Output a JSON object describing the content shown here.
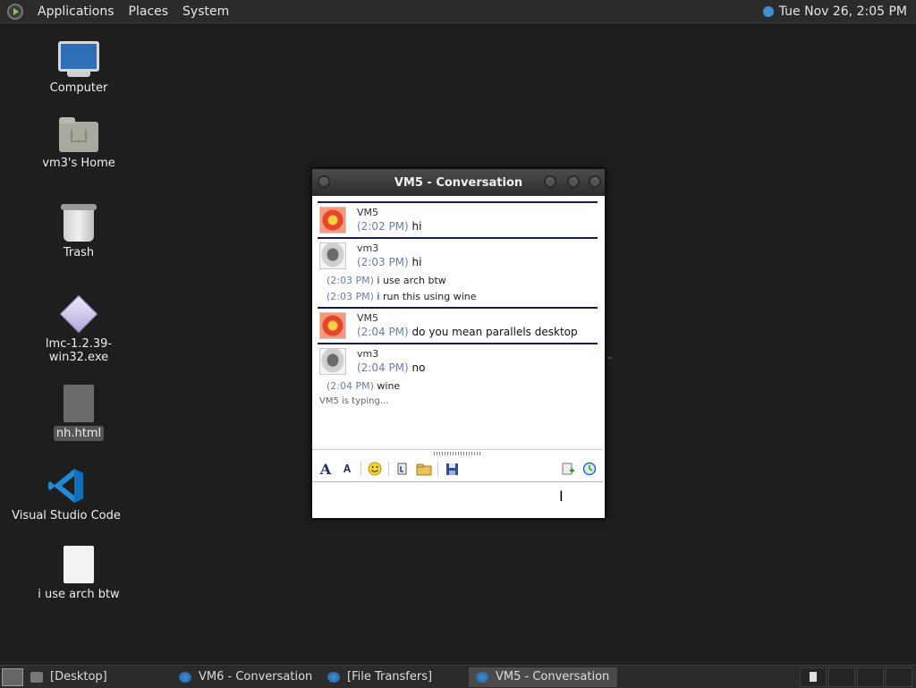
{
  "top_panel": {
    "menus": [
      "Applications",
      "Places",
      "System"
    ],
    "clock": "Tue Nov 26,  2:05 PM"
  },
  "desktop_icons": [
    {
      "label": "Computer"
    },
    {
      "label": "vm3's Home"
    },
    {
      "label": "Trash"
    },
    {
      "label": "lmc-1.2.39-win32.exe"
    },
    {
      "label": "nh.html"
    },
    {
      "label": "Visual Studio Code"
    },
    {
      "label": "i use arch btw"
    }
  ],
  "window": {
    "title": "VM5 - Conversation",
    "messages": [
      {
        "sender": "VM5",
        "time": "(2:02 PM)",
        "text": "hi",
        "extras": []
      },
      {
        "sender": "vm3",
        "time": "(2:03 PM)",
        "text": "hi",
        "extras": [
          {
            "time": "(2:03 PM)",
            "text": "i use arch btw"
          },
          {
            "time": "(2:03 PM)",
            "text": "i run this using wine"
          }
        ]
      },
      {
        "sender": "VM5",
        "time": "(2:04 PM)",
        "text": "do you mean parallels desktop",
        "extras": []
      },
      {
        "sender": "vm3",
        "time": "(2:04 PM)",
        "text": "no",
        "extras": [
          {
            "time": "(2:04 PM)",
            "text": "wine"
          }
        ]
      }
    ],
    "typing_status": "VM5 is typing..."
  },
  "taskbar": {
    "tasks": [
      {
        "label": "[Desktop]",
        "active": false
      },
      {
        "label": "VM6 - Conversation",
        "active": false
      },
      {
        "label": "[File Transfers]",
        "active": false
      },
      {
        "label": "VM5 - Conversation",
        "active": true
      }
    ]
  }
}
